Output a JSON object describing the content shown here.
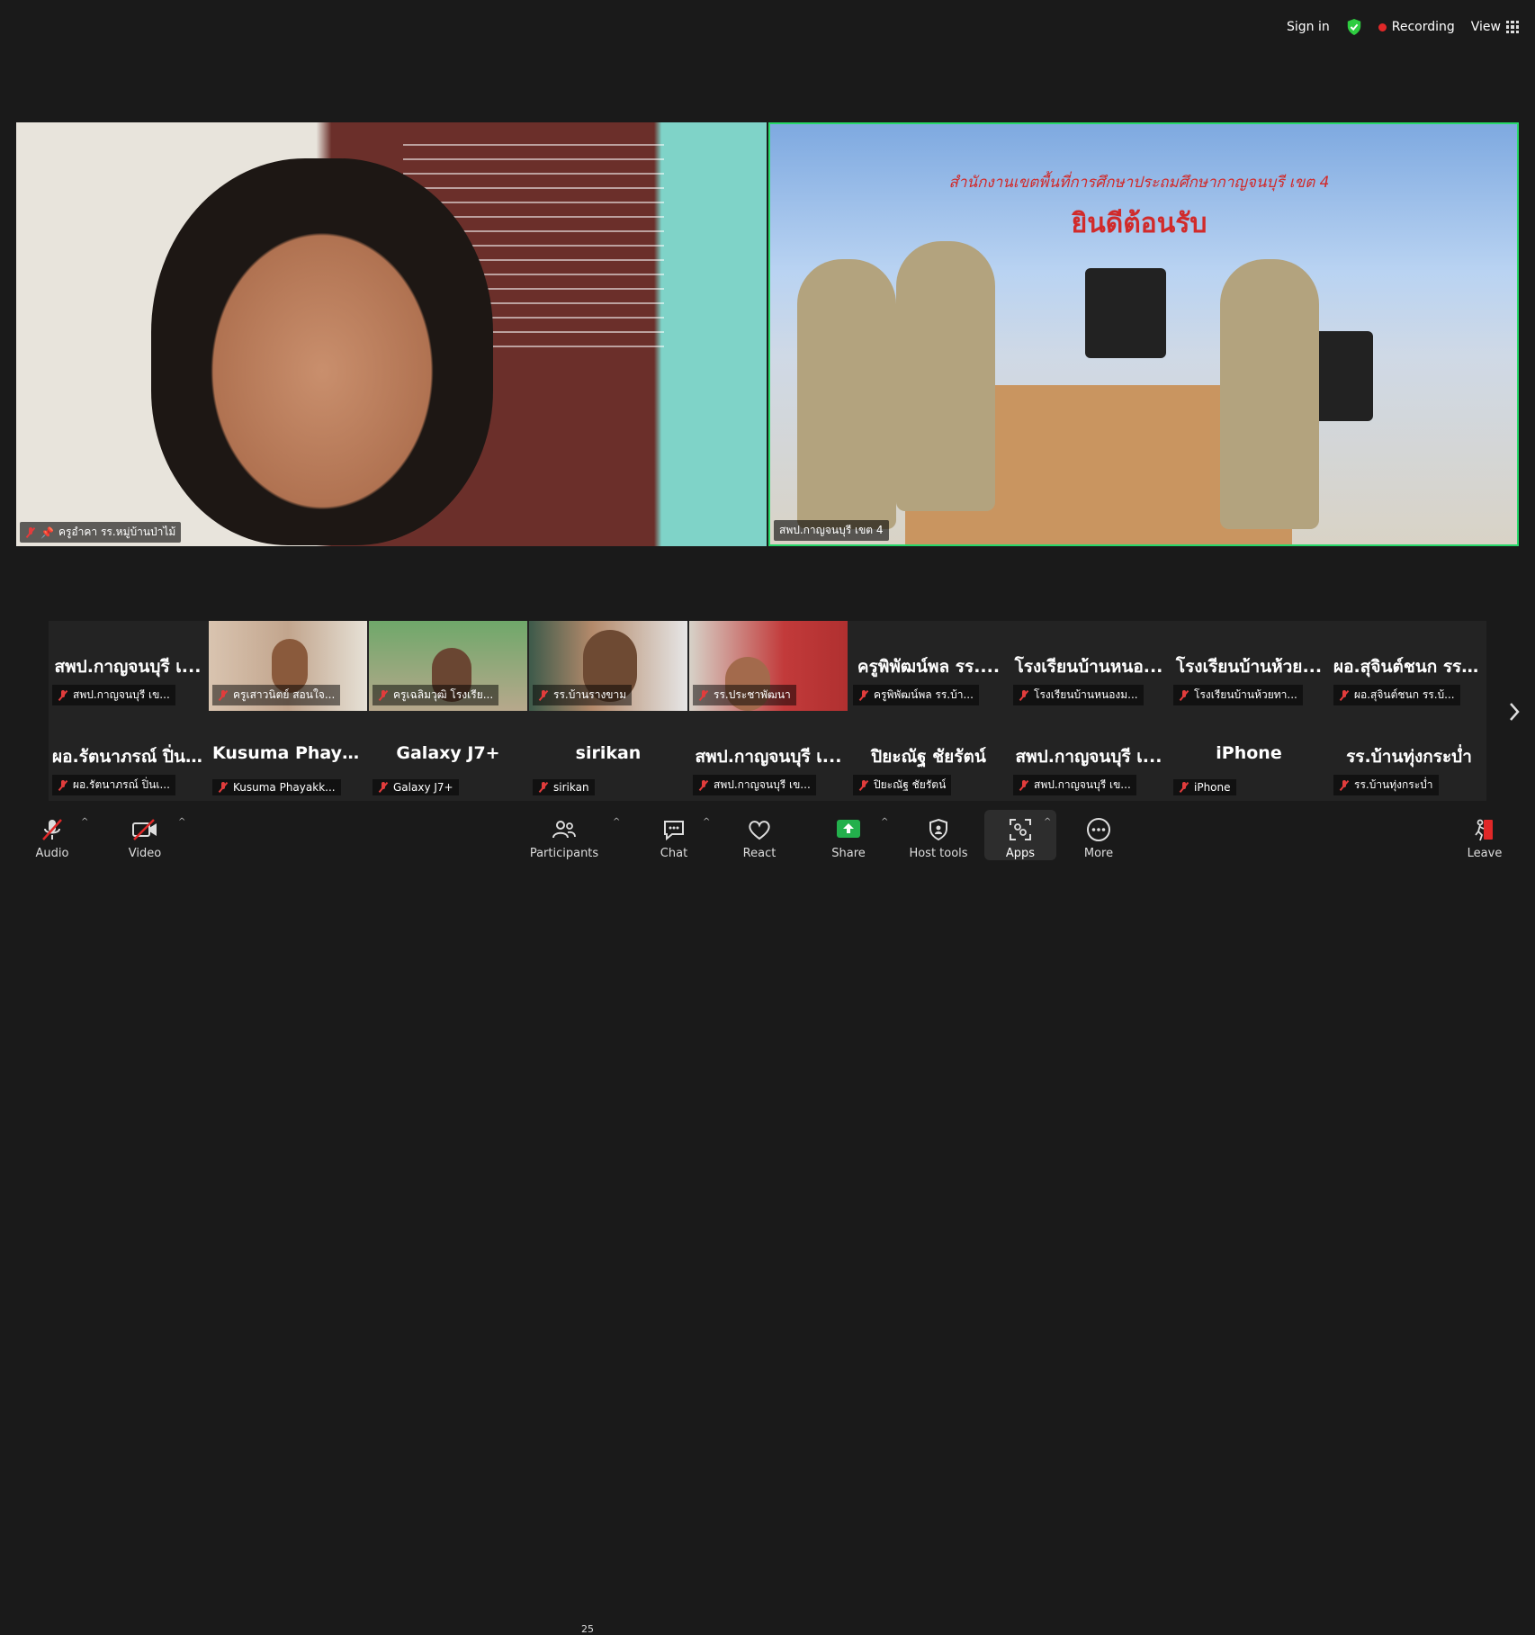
{
  "topbar": {
    "sign_in": "Sign in",
    "recording": "Recording",
    "view": "View",
    "shield_color": "#2ecc40",
    "record_color": "#e02828"
  },
  "main_videos": [
    {
      "name": "ครูอำคา รร.หมู่บ้านป่าไม้",
      "muted": true,
      "pinned": true
    },
    {
      "name": "สพป.กาญจนบุรี เขต 4",
      "muted": false,
      "active_speaker": true
    }
  ],
  "banner": {
    "line1": "สำนักงานเขตพื้นที่การศึกษาประถมศึกษากาญจนบุรี เขต 4",
    "line2": "ยินดีต้อนรับ"
  },
  "gallery_row1": [
    {
      "big": "สพป.กาญจนบุรี เ...",
      "tag": "สพป.กาญจนบุรี เข...",
      "has_video": false
    },
    {
      "big": "",
      "tag": "ครูเสาวนิตย์  สอนใจ...",
      "has_video": true
    },
    {
      "big": "",
      "tag": "ครูเฉลิมวุฒิ  โรงเรีย...",
      "has_video": true
    },
    {
      "big": "",
      "tag": "รร.บ้านรางขาม",
      "has_video": true
    },
    {
      "big": "",
      "tag": "รร.ประชาพัฒนา",
      "has_video": true
    },
    {
      "big": "ครูพิพัฒน์พล รร....",
      "tag": "ครูพิพัฒน์พล รร.บ้า...",
      "has_video": false
    },
    {
      "big": "โรงเรียนบ้านหนอ...",
      "tag": "โรงเรียนบ้านหนองม...",
      "has_video": false
    },
    {
      "big": "โรงเรียนบ้านห้วย...",
      "tag": "โรงเรียนบ้านห้วยทา...",
      "has_video": false
    },
    {
      "big": "ผอ.สุจินต์ชนก รร....",
      "tag": "ผอ.สุจินต์ชนก รร.บ้...",
      "has_video": false
    }
  ],
  "gallery_row2": [
    {
      "big": "ผอ.รัตนาภรณ์ ปิ่น...",
      "tag": "ผอ.รัตนาภรณ์ ปิ่นเ..."
    },
    {
      "big": "Kusuma  Phayak...",
      "tag": "Kusuma Phayakk..."
    },
    {
      "big": "Galaxy J7+",
      "tag": "Galaxy J7+"
    },
    {
      "big": "sirikan",
      "tag": "sirikan"
    },
    {
      "big": "สพป.กาญจนบุรี เ...",
      "tag": "สพป.กาญจนบุรี เข..."
    },
    {
      "big": "ปิยะณัฐ ชัยรัตน์",
      "tag": "ปิยะณัฐ ชัยรัตน์"
    },
    {
      "big": "สพป.กาญจนบุรี เ...",
      "tag": "สพป.กาญจนบุรี เข..."
    },
    {
      "big": "iPhone",
      "tag": "iPhone"
    },
    {
      "big": "รร.บ้านทุ่งกระบ่ำ",
      "tag": "รร.บ้านทุ่งกระบ่ำ"
    }
  ],
  "toolbar": {
    "audio": "Audio",
    "video": "Video",
    "participants": "Participants",
    "participants_count": "25",
    "chat": "Chat",
    "react": "React",
    "share": "Share",
    "host_tools": "Host tools",
    "apps": "Apps",
    "more": "More",
    "leave": "Leave",
    "share_color": "#23b04c",
    "leave_color": "#e02828"
  }
}
